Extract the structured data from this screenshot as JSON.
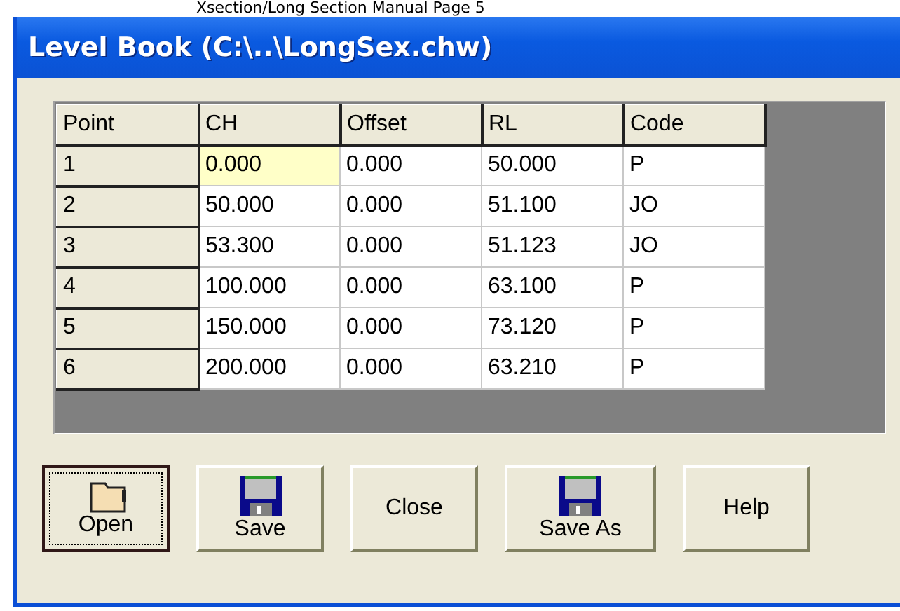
{
  "page_caption": "Xsection/Long Section Manual Page 5",
  "window": {
    "title": "Level Book (C:\\..\\LongSex.chw)"
  },
  "table": {
    "columns": [
      "Point",
      "CH",
      "Offset",
      "RL",
      "Code"
    ],
    "rows": [
      {
        "cells": [
          {
            "text": "1",
            "selected": false
          },
          {
            "text": "0.000",
            "selected": true
          },
          {
            "text": "0.000",
            "selected": false
          },
          {
            "text": "50.000",
            "selected": false
          },
          {
            "text": "P",
            "selected": false
          }
        ]
      },
      {
        "cells": [
          {
            "text": "2",
            "selected": false
          },
          {
            "text": "50.000",
            "selected": false
          },
          {
            "text": "0.000",
            "selected": false
          },
          {
            "text": "51.100",
            "selected": false
          },
          {
            "text": "JO",
            "selected": false
          }
        ]
      },
      {
        "cells": [
          {
            "text": "3",
            "selected": false
          },
          {
            "text": "53.300",
            "selected": false
          },
          {
            "text": "0.000",
            "selected": false
          },
          {
            "text": "51.123",
            "selected": false
          },
          {
            "text": "JO",
            "selected": false
          }
        ]
      },
      {
        "cells": [
          {
            "text": "4",
            "selected": false
          },
          {
            "text": "100.000",
            "selected": false
          },
          {
            "text": "0.000",
            "selected": false
          },
          {
            "text": "63.100",
            "selected": false
          },
          {
            "text": "P",
            "selected": false
          }
        ]
      },
      {
        "cells": [
          {
            "text": "5",
            "selected": false
          },
          {
            "text": "150.000",
            "selected": false
          },
          {
            "text": "0.000",
            "selected": false
          },
          {
            "text": "73.120",
            "selected": false
          },
          {
            "text": "P",
            "selected": false
          }
        ]
      },
      {
        "cells": [
          {
            "text": "6",
            "selected": false
          },
          {
            "text": "200.000",
            "selected": false
          },
          {
            "text": "0.000",
            "selected": false
          },
          {
            "text": "63.210",
            "selected": false
          },
          {
            "text": "P",
            "selected": false
          }
        ]
      }
    ]
  },
  "buttons": [
    {
      "label": "Open",
      "kind": "folder",
      "default": true
    },
    {
      "label": "Save",
      "kind": "floppy",
      "default": false
    },
    {
      "label": "Close",
      "kind": "plain",
      "default": false
    },
    {
      "label": "Save As",
      "kind": "floppy",
      "default": false
    },
    {
      "label": "Help",
      "kind": "plain",
      "default": false
    }
  ]
}
